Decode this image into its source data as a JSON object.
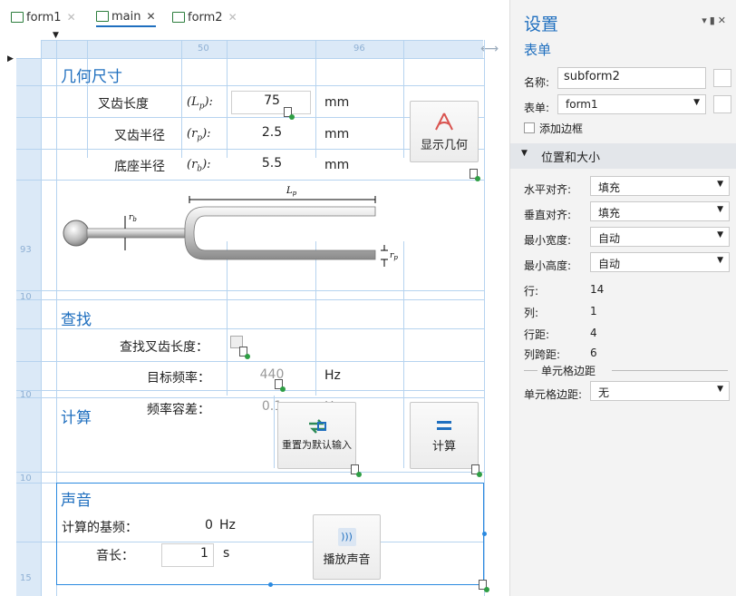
{
  "tabs": [
    {
      "label": "form1",
      "active": false
    },
    {
      "label": "main",
      "active": true
    },
    {
      "label": "form2",
      "active": false
    }
  ],
  "ruler": {
    "top": [
      "50",
      "96"
    ],
    "left": [
      "93",
      "10",
      "10",
      "10",
      "15"
    ]
  },
  "geometry": {
    "title": "几何尺寸",
    "rows": [
      {
        "label": "叉齿长度",
        "symbol_base": "L",
        "symbol_sub": "p",
        "value": "75",
        "unit": "mm"
      },
      {
        "label": "叉齿半径",
        "symbol_base": "r",
        "symbol_sub": "p",
        "value": "2.5",
        "unit": "mm"
      },
      {
        "label": "底座半径",
        "symbol_base": "r",
        "symbol_sub": "b",
        "value": "5.5",
        "unit": "mm"
      }
    ],
    "show_button": "显示几何",
    "diagram": {
      "dim_length": "L",
      "dim_length_sub": "p",
      "dim_base": "r",
      "dim_base_sub": "b",
      "dim_prong": "r",
      "dim_prong_sub": "p"
    }
  },
  "search": {
    "title": "查找",
    "find_label": "查找叉齿长度：",
    "target_label": "目标频率：",
    "target_value": "440",
    "target_unit": "Hz",
    "tolerance_label": "频率容差：",
    "tolerance_value": "0.1",
    "tolerance_unit": "Hz"
  },
  "compute": {
    "title": "计算",
    "reset_button": "重置为默认输入",
    "compute_button": "计算"
  },
  "sound": {
    "title": "声音",
    "freq_label": "计算的基频：",
    "freq_value": "0",
    "freq_unit": "Hz",
    "duration_label": "音长：",
    "duration_value": "1",
    "duration_unit": "s",
    "play_button": "播放声音"
  },
  "settings": {
    "title": "设置",
    "subtitle": "表单",
    "name_label": "名称:",
    "name_value": "subform2",
    "form_label": "表单:",
    "form_value": "form1",
    "add_border": "添加边框",
    "section": "位置和大小",
    "fields": [
      {
        "label": "水平对齐:",
        "value": "填充"
      },
      {
        "label": "垂直对齐:",
        "value": "填充"
      },
      {
        "label": "最小宽度:",
        "value": "自动"
      },
      {
        "label": "最小高度:",
        "value": "自动"
      }
    ],
    "stats": [
      {
        "label": "行:",
        "value": "14"
      },
      {
        "label": "列:",
        "value": "1"
      },
      {
        "label": "行距:",
        "value": "4"
      },
      {
        "label": "列跨距:",
        "value": "6"
      }
    ],
    "cell_margin_section": "单元格边距",
    "cell_margin_label": "单元格边距:",
    "cell_margin_value": "无"
  },
  "colors": {
    "accent": "#1f6fbf",
    "grid": "#b6d3ef",
    "ruler": "#dbe9f7",
    "selection": "#2b8ae0"
  }
}
